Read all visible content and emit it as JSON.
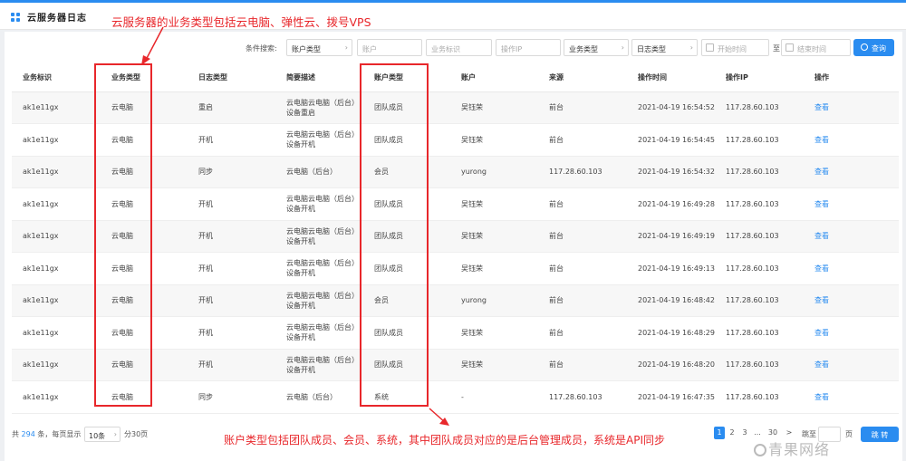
{
  "header": {
    "title": "云服务器日志"
  },
  "annotations": {
    "top": "云服务器的业务类型包括云电脑、弹性云、拨号VPS",
    "bottom": "账户类型包括团队成员、会员、系统，其中团队成员对应的是后台管理成员，系统是API同步"
  },
  "search": {
    "label": "条件搜索:",
    "account_type": "账户类型",
    "account_placeholder": "账户",
    "business_id_placeholder": "业务标识",
    "operation_ip_placeholder": "操作IP",
    "business_type": "业务类型",
    "log_type": "日志类型",
    "start_time_placeholder": "开始时间",
    "separator": "至",
    "end_time_placeholder": "结束时间",
    "query_label": "查询"
  },
  "table": {
    "columns": [
      "业务标识",
      "业务类型",
      "日志类型",
      "简要描述",
      "账户类型",
      "账户",
      "来源",
      "操作时间",
      "操作IP",
      "操作"
    ],
    "rows": [
      [
        "ak1e11gx",
        "云电脑",
        "重启",
        "云电脑云电脑（后台）设备重启",
        "团队成员",
        "吴钰荣",
        "前台",
        "2021-04-19 16:54:52",
        "117.28.60.103",
        "查看"
      ],
      [
        "ak1e11gx",
        "云电脑",
        "开机",
        "云电脑云电脑（后台）设备开机",
        "团队成员",
        "吴钰荣",
        "前台",
        "2021-04-19 16:54:45",
        "117.28.60.103",
        "查看"
      ],
      [
        "ak1e11gx",
        "云电脑",
        "同步",
        "云电脑（后台）",
        "会员",
        "yurong",
        "117.28.60.103",
        "2021-04-19 16:54:32",
        "117.28.60.103",
        "查看"
      ],
      [
        "ak1e11gx",
        "云电脑",
        "开机",
        "云电脑云电脑（后台）设备开机",
        "团队成员",
        "吴钰荣",
        "前台",
        "2021-04-19 16:49:28",
        "117.28.60.103",
        "查看"
      ],
      [
        "ak1e11gx",
        "云电脑",
        "开机",
        "云电脑云电脑（后台）设备开机",
        "团队成员",
        "吴钰荣",
        "前台",
        "2021-04-19 16:49:19",
        "117.28.60.103",
        "查看"
      ],
      [
        "ak1e11gx",
        "云电脑",
        "开机",
        "云电脑云电脑（后台）设备开机",
        "团队成员",
        "吴钰荣",
        "前台",
        "2021-04-19 16:49:13",
        "117.28.60.103",
        "查看"
      ],
      [
        "ak1e11gx",
        "云电脑",
        "开机",
        "云电脑云电脑（后台）设备开机",
        "会员",
        "yurong",
        "前台",
        "2021-04-19 16:48:42",
        "117.28.60.103",
        "查看"
      ],
      [
        "ak1e11gx",
        "云电脑",
        "开机",
        "云电脑云电脑（后台）设备开机",
        "团队成员",
        "吴钰荣",
        "前台",
        "2021-04-19 16:48:29",
        "117.28.60.103",
        "查看"
      ],
      [
        "ak1e11gx",
        "云电脑",
        "开机",
        "云电脑云电脑（后台）设备开机",
        "团队成员",
        "吴钰荣",
        "前台",
        "2021-04-19 16:48:20",
        "117.28.60.103",
        "查看"
      ],
      [
        "ak1e11gx",
        "云电脑",
        "同步",
        "云电脑（后台）",
        "系统",
        "-",
        "117.28.60.103",
        "2021-04-19 16:47:35",
        "117.28.60.103",
        "查看"
      ]
    ]
  },
  "pagination": {
    "total_prefix": "共",
    "total": "294",
    "total_suffix": "条，每页显示",
    "page_size": "10条",
    "total_pages": "分30页",
    "pages": [
      "1",
      "2",
      "3",
      "...",
      "30",
      ">"
    ],
    "current_page": "1",
    "jump_label": "跳至",
    "page_label": "页",
    "go_label": "跳 转"
  },
  "watermark": "青果网络",
  "colors": {
    "accent": "#2a8cf0",
    "annotation": "#e8272b"
  }
}
